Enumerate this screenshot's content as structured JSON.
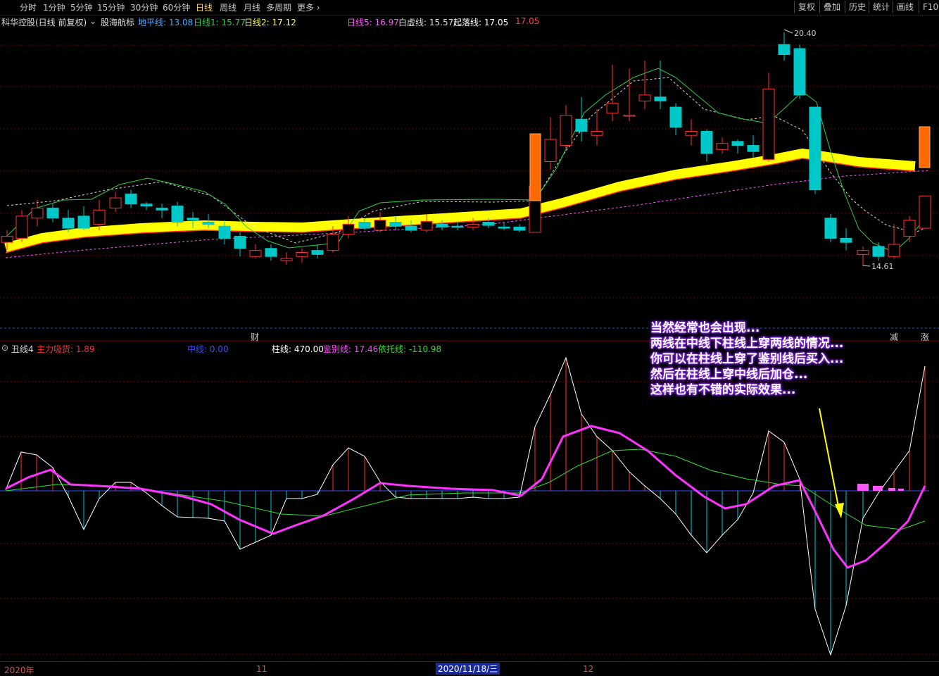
{
  "toolbar": {
    "periods": [
      "分时",
      "1分钟",
      "5分钟",
      "15分钟",
      "30分钟",
      "60分钟",
      "日线",
      "周线",
      "月线",
      "多周期",
      "更多"
    ],
    "active_period": "日线",
    "right_buttons": [
      "复权",
      "叠加",
      "历史",
      "统计",
      "画线",
      "F10"
    ]
  },
  "info": {
    "stock": "科华控股",
    "mode": "(日线 前复权)",
    "indicator": "股海航标",
    "items": [
      {
        "label": "地平线:",
        "value": "13.08",
        "color": "#4aa8ff"
      },
      {
        "label": "日线1:",
        "value": "15.77",
        "color": "#2ecc40"
      },
      {
        "label": "日线2:",
        "value": "17.12",
        "color": "#ffff55"
      },
      {
        "label": "日线5:",
        "value": "16.97",
        "color": "#ff55ff"
      },
      {
        "label": "白虚线:",
        "value": "15.57",
        "color": "#dddddd"
      },
      {
        "label": "起落线:",
        "value": "17.05",
        "color": "#ffffff"
      },
      {
        "label": "",
        "value": "17.05",
        "color": "#ff4040"
      }
    ],
    "price_high": "20.40",
    "price_low": "14.61"
  },
  "sub": {
    "name": "丑线4",
    "items": [
      {
        "label": "主力吸货:",
        "value": "1.89",
        "color": "#ff3030"
      },
      {
        "label": "中线:",
        "value": "0.00",
        "color": "#3050ff"
      },
      {
        "label": "柱线:",
        "value": "470.00",
        "color": "#ffffff"
      },
      {
        "label": "鉴别线:",
        "value": "17.46",
        "color": "#ff44ff"
      },
      {
        "label": "依托线:",
        "value": "-110.98",
        "color": "#33dd33"
      }
    ]
  },
  "events": [
    {
      "text": "财",
      "color": "#4aa8ff"
    },
    {
      "text": "减",
      "color": "#33dd33"
    },
    {
      "text": "涨",
      "color": "#ff4040"
    }
  ],
  "annotation": [
    "当然经常也会出现...",
    "两线在中线下柱线上穿两线的情况...",
    "你可以在柱线上穿了鉴别线后买入...",
    "然后在柱线上穿中线后加仓...",
    "这样也有不错的实际效果..."
  ],
  "date_axis": {
    "labels": [
      "2020年",
      "11",
      "12"
    ],
    "cursor": "2020/11/18/三"
  },
  "colors": {
    "up": "#ff3030",
    "down": "#00c8c8",
    "mid": "#3050ff",
    "grid": "#7a0000"
  }
}
